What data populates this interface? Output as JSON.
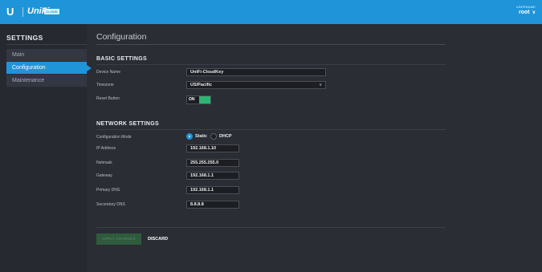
{
  "header": {
    "logo_word": "UniFi",
    "logo_badge": "CLOUD KEY",
    "username_label": "USERNAME",
    "username": "root"
  },
  "sidebar": {
    "title": "SETTINGS",
    "items": [
      {
        "label": "Main"
      },
      {
        "label": "Configuration"
      },
      {
        "label": "Maintenance"
      }
    ]
  },
  "main": {
    "title": "Configuration",
    "basic": {
      "heading": "BASIC SETTINGS",
      "device_name_label": "Device Name",
      "device_name_value": "UniFi-CloudKey",
      "timezone_label": "Timezone",
      "timezone_value": "US/Pacific",
      "reset_label": "Reset Button",
      "reset_state": "ON"
    },
    "network": {
      "heading": "NETWORK SETTINGS",
      "mode_label": "Configuration Mode",
      "mode_static": "Static",
      "mode_dhcp": "DHCP",
      "ip_label": "IP Address",
      "ip_value": "192.168.1.10",
      "netmask_label": "Netmask",
      "netmask_value": "255.255.255.0",
      "gateway_label": "Gateway",
      "gateway_value": "192.168.1.1",
      "dns1_label": "Primary DNS",
      "dns1_value": "192.168.1.1",
      "dns2_label": "Secondary DNS",
      "dns2_value": "8.8.8.8"
    },
    "actions": {
      "apply_label": "APPLY CHANGES",
      "discard_label": "DISCARD"
    }
  },
  "colors": {
    "accent": "#1f94d8",
    "toggle_on": "#2bb673",
    "background": "#2a2d34"
  },
  "icons": {
    "logo": "ubiquiti-u-logo",
    "user_menu": "chevron-down-icon",
    "timezone_dropdown": "chevron-down-icon"
  }
}
